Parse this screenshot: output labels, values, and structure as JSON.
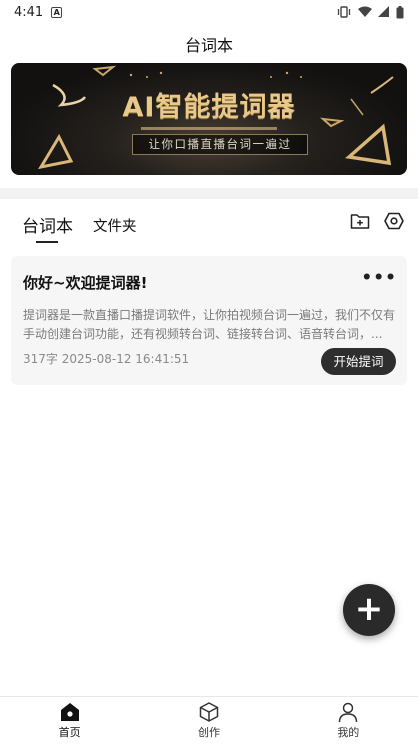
{
  "status_bar": {
    "time": "4:41"
  },
  "header": {
    "title": "台词本"
  },
  "banner": {
    "title": "AI智能提词器",
    "subtitle": "让你口播直播台词一遍过"
  },
  "tabs": [
    {
      "label": "台词本",
      "active": true
    },
    {
      "label": "文件夹",
      "active": false
    }
  ],
  "tab_actions": [
    "add-folder-icon",
    "settings-icon"
  ],
  "card": {
    "title": "你好~欢迎提词器!",
    "more": "•••",
    "body": "提词器是一款直播口播提词软件，让你拍视频台词一遍过，我们不仅有手动创建台词功能，还有视频转台词、链接转台词、语音转台词，...",
    "meta": "317字 2025-08-12 16:41:51",
    "button": "开始提词"
  },
  "fab": {
    "symbol": "+"
  },
  "bottom_nav": [
    {
      "label": "首页",
      "icon": "home-icon",
      "active": true
    },
    {
      "label": "创作",
      "icon": "cube-icon",
      "active": false
    },
    {
      "label": "我的",
      "icon": "person-icon",
      "active": false
    }
  ],
  "colors": {
    "accent_dark": "#2e2e2e",
    "banner_gold": "#e9c98a",
    "band_gray": "#f2f2f2"
  }
}
